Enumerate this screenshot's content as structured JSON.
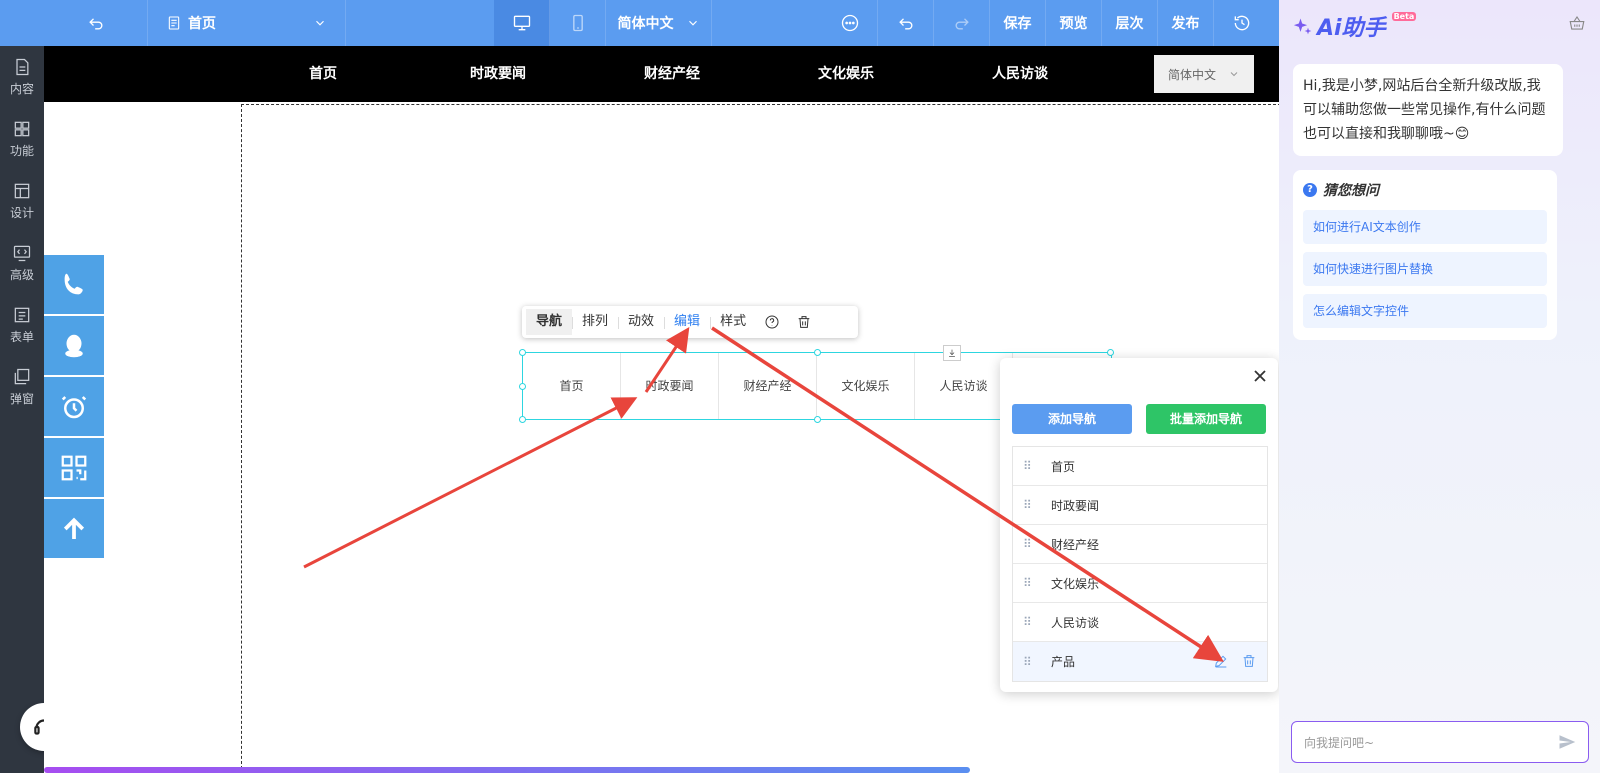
{
  "topbar": {
    "page_name": "首页",
    "lang": "简体中文",
    "save": "保存",
    "preview": "预览",
    "layers": "层次",
    "publish": "发布"
  },
  "sidebar": {
    "items": [
      {
        "label": "内容",
        "icon": "document-icon"
      },
      {
        "label": "功能",
        "icon": "grid-icon"
      },
      {
        "label": "设计",
        "icon": "layout-icon"
      },
      {
        "label": "高级",
        "icon": "code-icon"
      },
      {
        "label": "表单",
        "icon": "form-icon"
      },
      {
        "label": "弹窗",
        "icon": "popup-icon"
      }
    ]
  },
  "site_nav": {
    "items": [
      "首页",
      "时政要闻",
      "财经产经",
      "文化娱乐",
      "人民访谈"
    ],
    "lang": "简体中文"
  },
  "widget_toolbar": {
    "tabs": [
      "导航",
      "排列",
      "动效",
      "编辑",
      "样式"
    ]
  },
  "widget": {
    "items": [
      "首页",
      "时政要闻",
      "财经产经",
      "文化娱乐",
      "人民访谈"
    ]
  },
  "edit_panel": {
    "add_nav": "添加导航",
    "batch_add_nav": "批量添加导航",
    "rows": [
      "首页",
      "时政要闻",
      "财经产经",
      "文化娱乐",
      "人民访谈",
      "产品"
    ]
  },
  "ai": {
    "logo": "Ai助手",
    "beta": "Beta",
    "greeting": "Hi,我是小梦,网站后台全新升级改版,我可以辅助您做一些常见操作,有什么问题也可以直接和我聊聊哦~😊",
    "guess_title": "猜您想问",
    "questions": [
      "如何进行AI文本创作",
      "如何快速进行图片替换",
      "怎么编辑文字控件"
    ],
    "input_placeholder": "向我提问吧~"
  },
  "colors": {
    "topbar": "#5b9cf0",
    "sidebar": "#2f3640",
    "accent_blue": "#2f7ff0",
    "green": "#2ec567",
    "arrow": "#e8453c"
  }
}
